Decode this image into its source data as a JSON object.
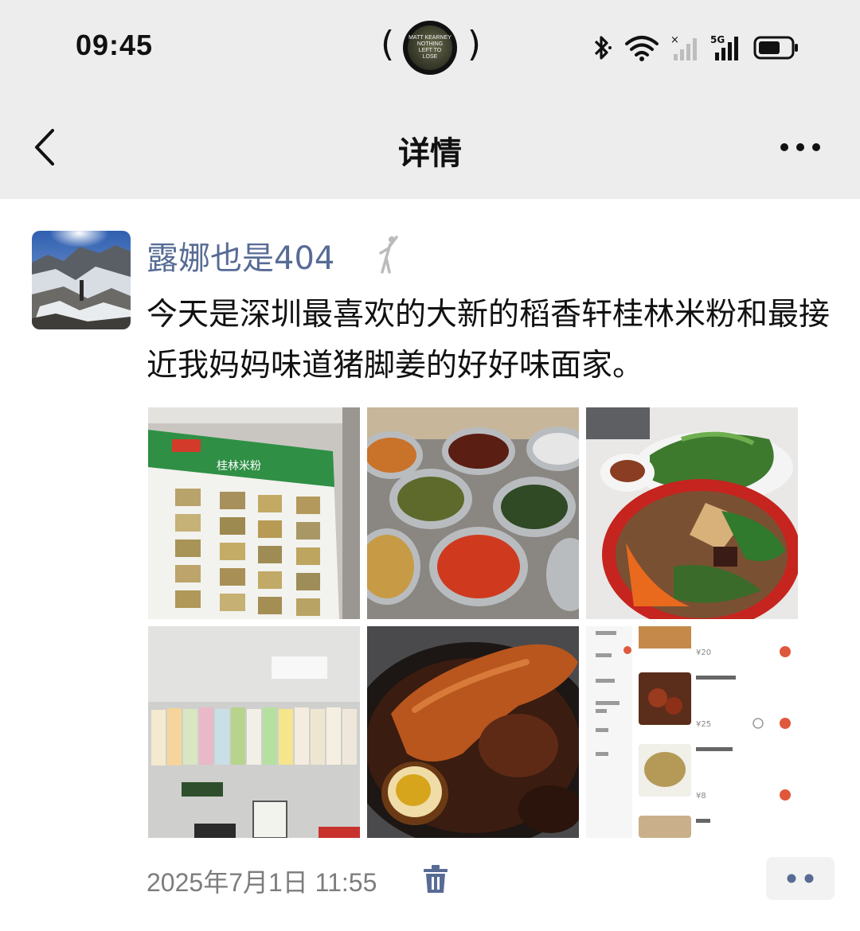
{
  "status_bar": {
    "time": "09:45",
    "island_text": [
      "MATT KEARNEY",
      "NOTHING",
      "LEFT TO",
      "LOSE"
    ],
    "network": "5G"
  },
  "nav": {
    "title": "详情",
    "back_icon": "chevron-left-icon",
    "more_icon": "ellipsis-icon"
  },
  "post": {
    "username": "露娜也是404",
    "text": "今天是深圳最喜欢的大新的稻香轩桂林米粉和最接近我妈妈味道猪脚姜的好好味面家。",
    "timestamp": "2025年7月1日 11:55",
    "images": [
      {
        "desc": "menu-board"
      },
      {
        "desc": "condiment-tubs"
      },
      {
        "desc": "guilin-rice-noodle-bowl"
      },
      {
        "desc": "wall-paper-menu-strips"
      },
      {
        "desc": "pork-trotter-ginger"
      },
      {
        "desc": "ordering-app-screenshot"
      }
    ],
    "menu_board_title": "桂林米粉",
    "app_prices": [
      "¥20",
      "¥25",
      "¥8"
    ],
    "accent_color": "#576b95"
  }
}
